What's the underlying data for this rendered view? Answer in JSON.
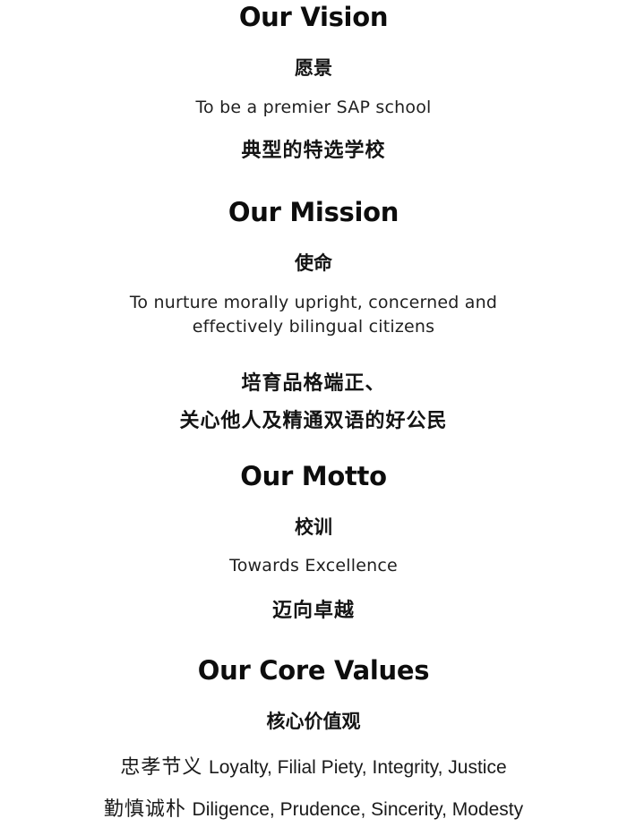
{
  "vision": {
    "heading": "Our Vision",
    "subheading_cn": "愿景",
    "text_en": "To be a premier SAP school",
    "text_cn": "典型的特选学校"
  },
  "mission": {
    "heading": "Our Mission",
    "subheading_cn": "使命",
    "text_en_line1": "To nurture morally upright, concerned and",
    "text_en_line2": "effectively bilingual citizens",
    "text_cn_line1": "培育品格端正、",
    "text_cn_line2": "关心他人及精通双语的好公民"
  },
  "motto": {
    "heading": "Our Motto",
    "subheading_cn": "校训",
    "text_en": "Towards Excellence",
    "text_cn": "迈向卓越"
  },
  "core_values": {
    "heading": "Our Core Values",
    "subheading_cn": "核心价值观",
    "rows": [
      {
        "cn": "忠孝节义",
        "en": "Loyalty, Filial Piety, Integrity, Justice"
      },
      {
        "cn": "勤慎诚朴",
        "en": "Diligence, Prudence, Sincerity, Modesty"
      }
    ]
  }
}
